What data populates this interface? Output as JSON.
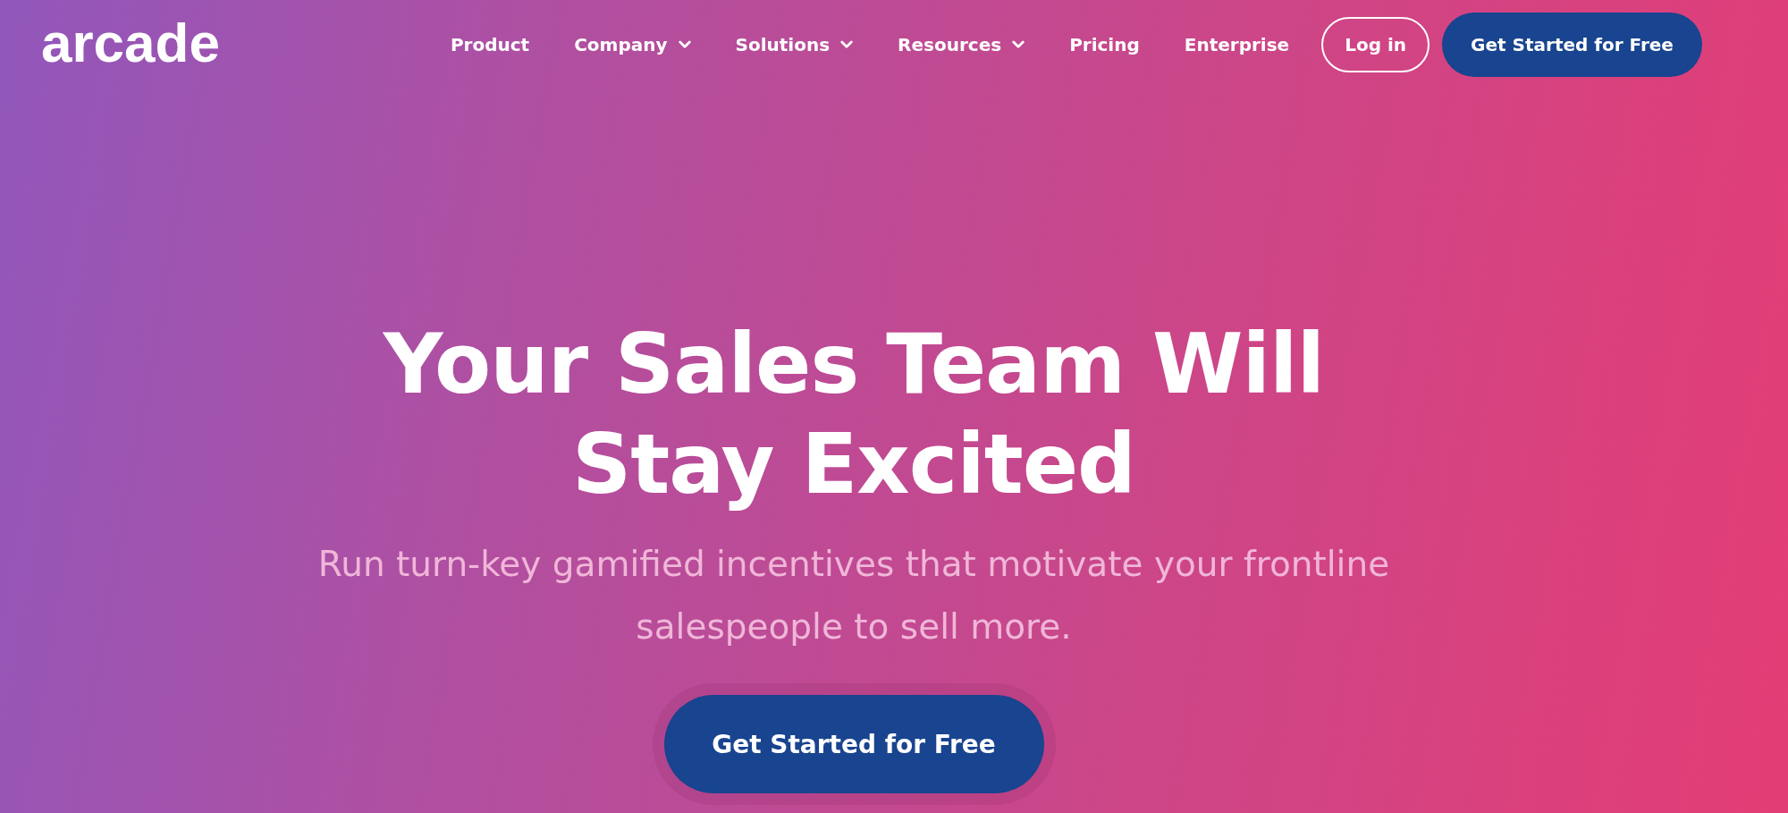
{
  "logo": "arcade",
  "nav": [
    {
      "label": "Product",
      "has_dropdown": false
    },
    {
      "label": "Company",
      "has_dropdown": true
    },
    {
      "label": "Solutions",
      "has_dropdown": true
    },
    {
      "label": "Resources",
      "has_dropdown": true
    },
    {
      "label": "Pricing",
      "has_dropdown": false
    },
    {
      "label": "Enterprise",
      "has_dropdown": false
    }
  ],
  "header_buttons": [
    {
      "label": "Log in",
      "kind": "outline"
    },
    {
      "label": "Get Started for Free",
      "kind": "filled"
    }
  ],
  "hero": {
    "heading_lines": [
      "Your Sales Team Will",
      "Stay Excited"
    ],
    "subtitle": "Run turn-key gamified incentives that motivate your frontline salespeople to sell more.",
    "cta": "Get Started for Free"
  }
}
